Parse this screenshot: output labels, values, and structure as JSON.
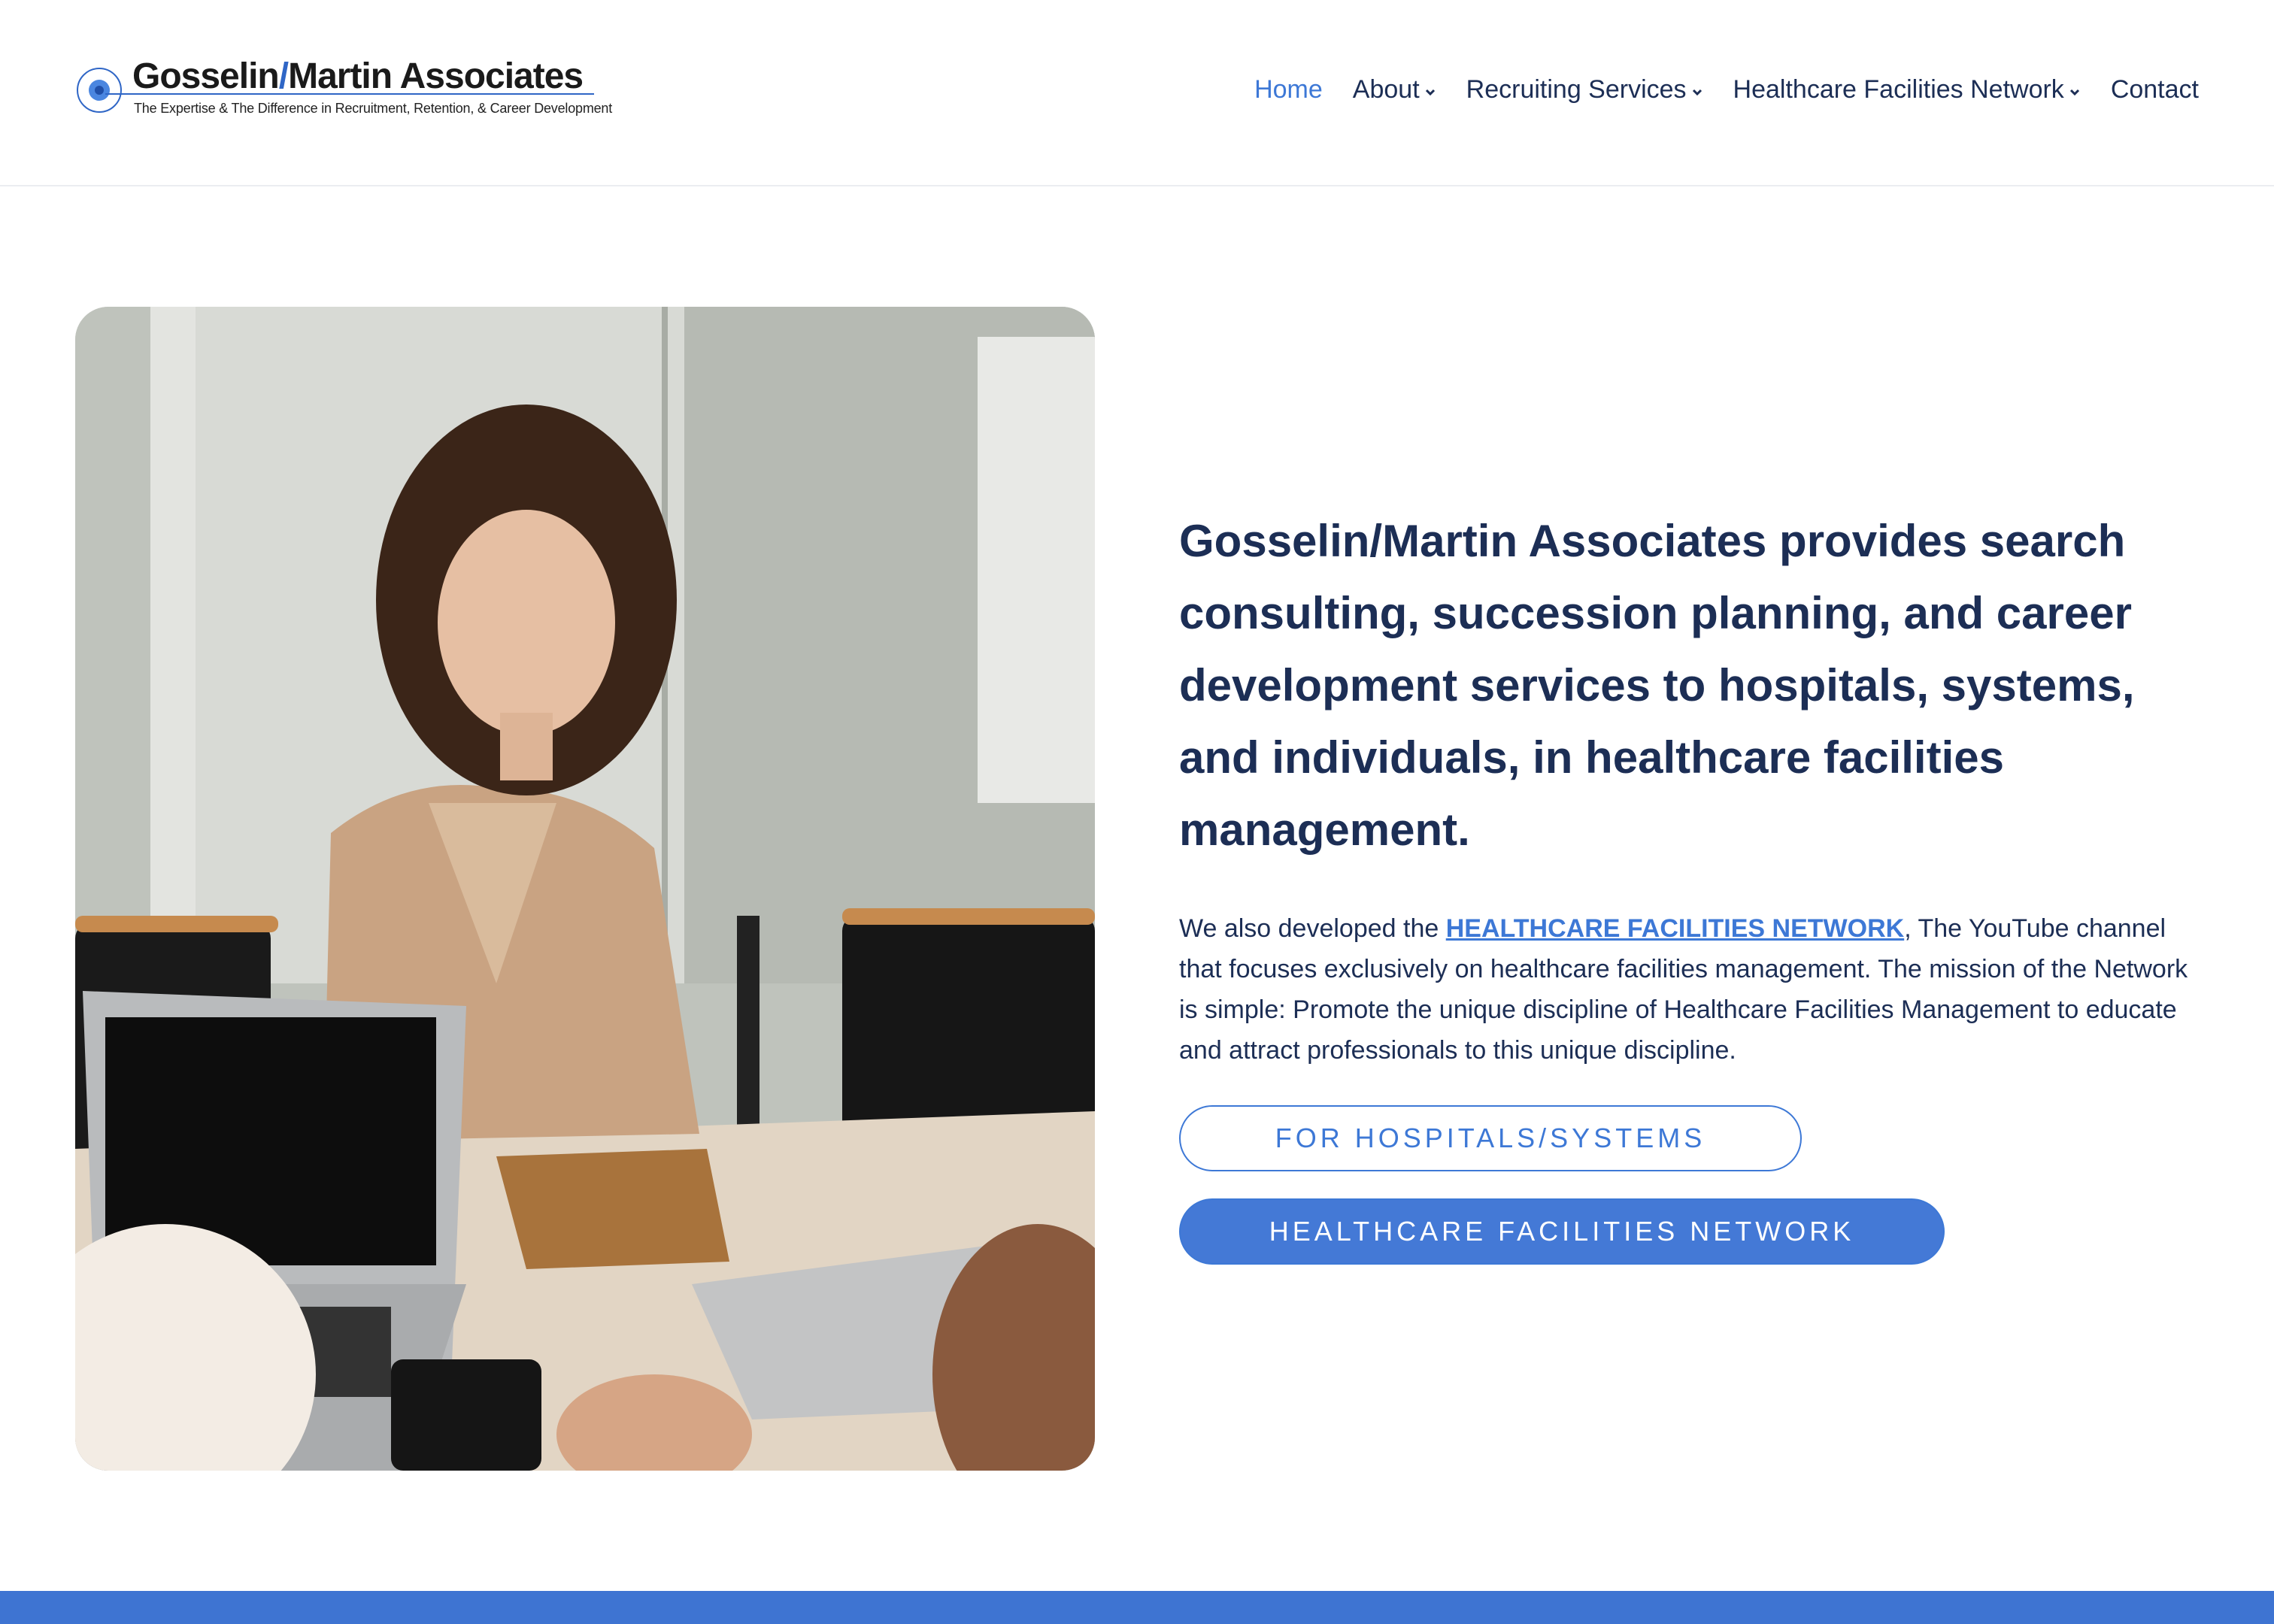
{
  "brand": {
    "title_part1": "Gosselin",
    "title_slash": "/",
    "title_part2": "Martin Associates",
    "tagline": "The Expertise & The Difference in Recruitment, Retention, & Career Development"
  },
  "nav": {
    "home": "Home",
    "about": "About",
    "recruiting": "Recruiting Services",
    "network": "Healthcare Facilities Network",
    "contact": "Contact"
  },
  "hero": {
    "headline": "Gosselin/Martin Associates provides search consulting, succession planning, and career development services to hospitals, systems, and individuals, in healthcare facilities management.",
    "para_before": "We also developed the ",
    "para_link": "HEALTHCARE FACILITIES NETWORK",
    "para_after": ", The YouTube channel that focuses exclusively on healthcare facilities management. The mission of the Network is simple: Promote the unique discipline of Healthcare Facilities Management to educate and attract professionals to this unique discipline.",
    "button_hospitals": "FOR HOSPITALS/SYSTEMS",
    "button_network": "HEALTHCARE FACILITIES NETWORK"
  },
  "colors": {
    "accent": "#3d78d6",
    "text": "#1c2e55",
    "footer": "#3e74d2"
  },
  "icons": {
    "logo": "target-circle-icon",
    "dropdown": "chevron-down-icon"
  }
}
